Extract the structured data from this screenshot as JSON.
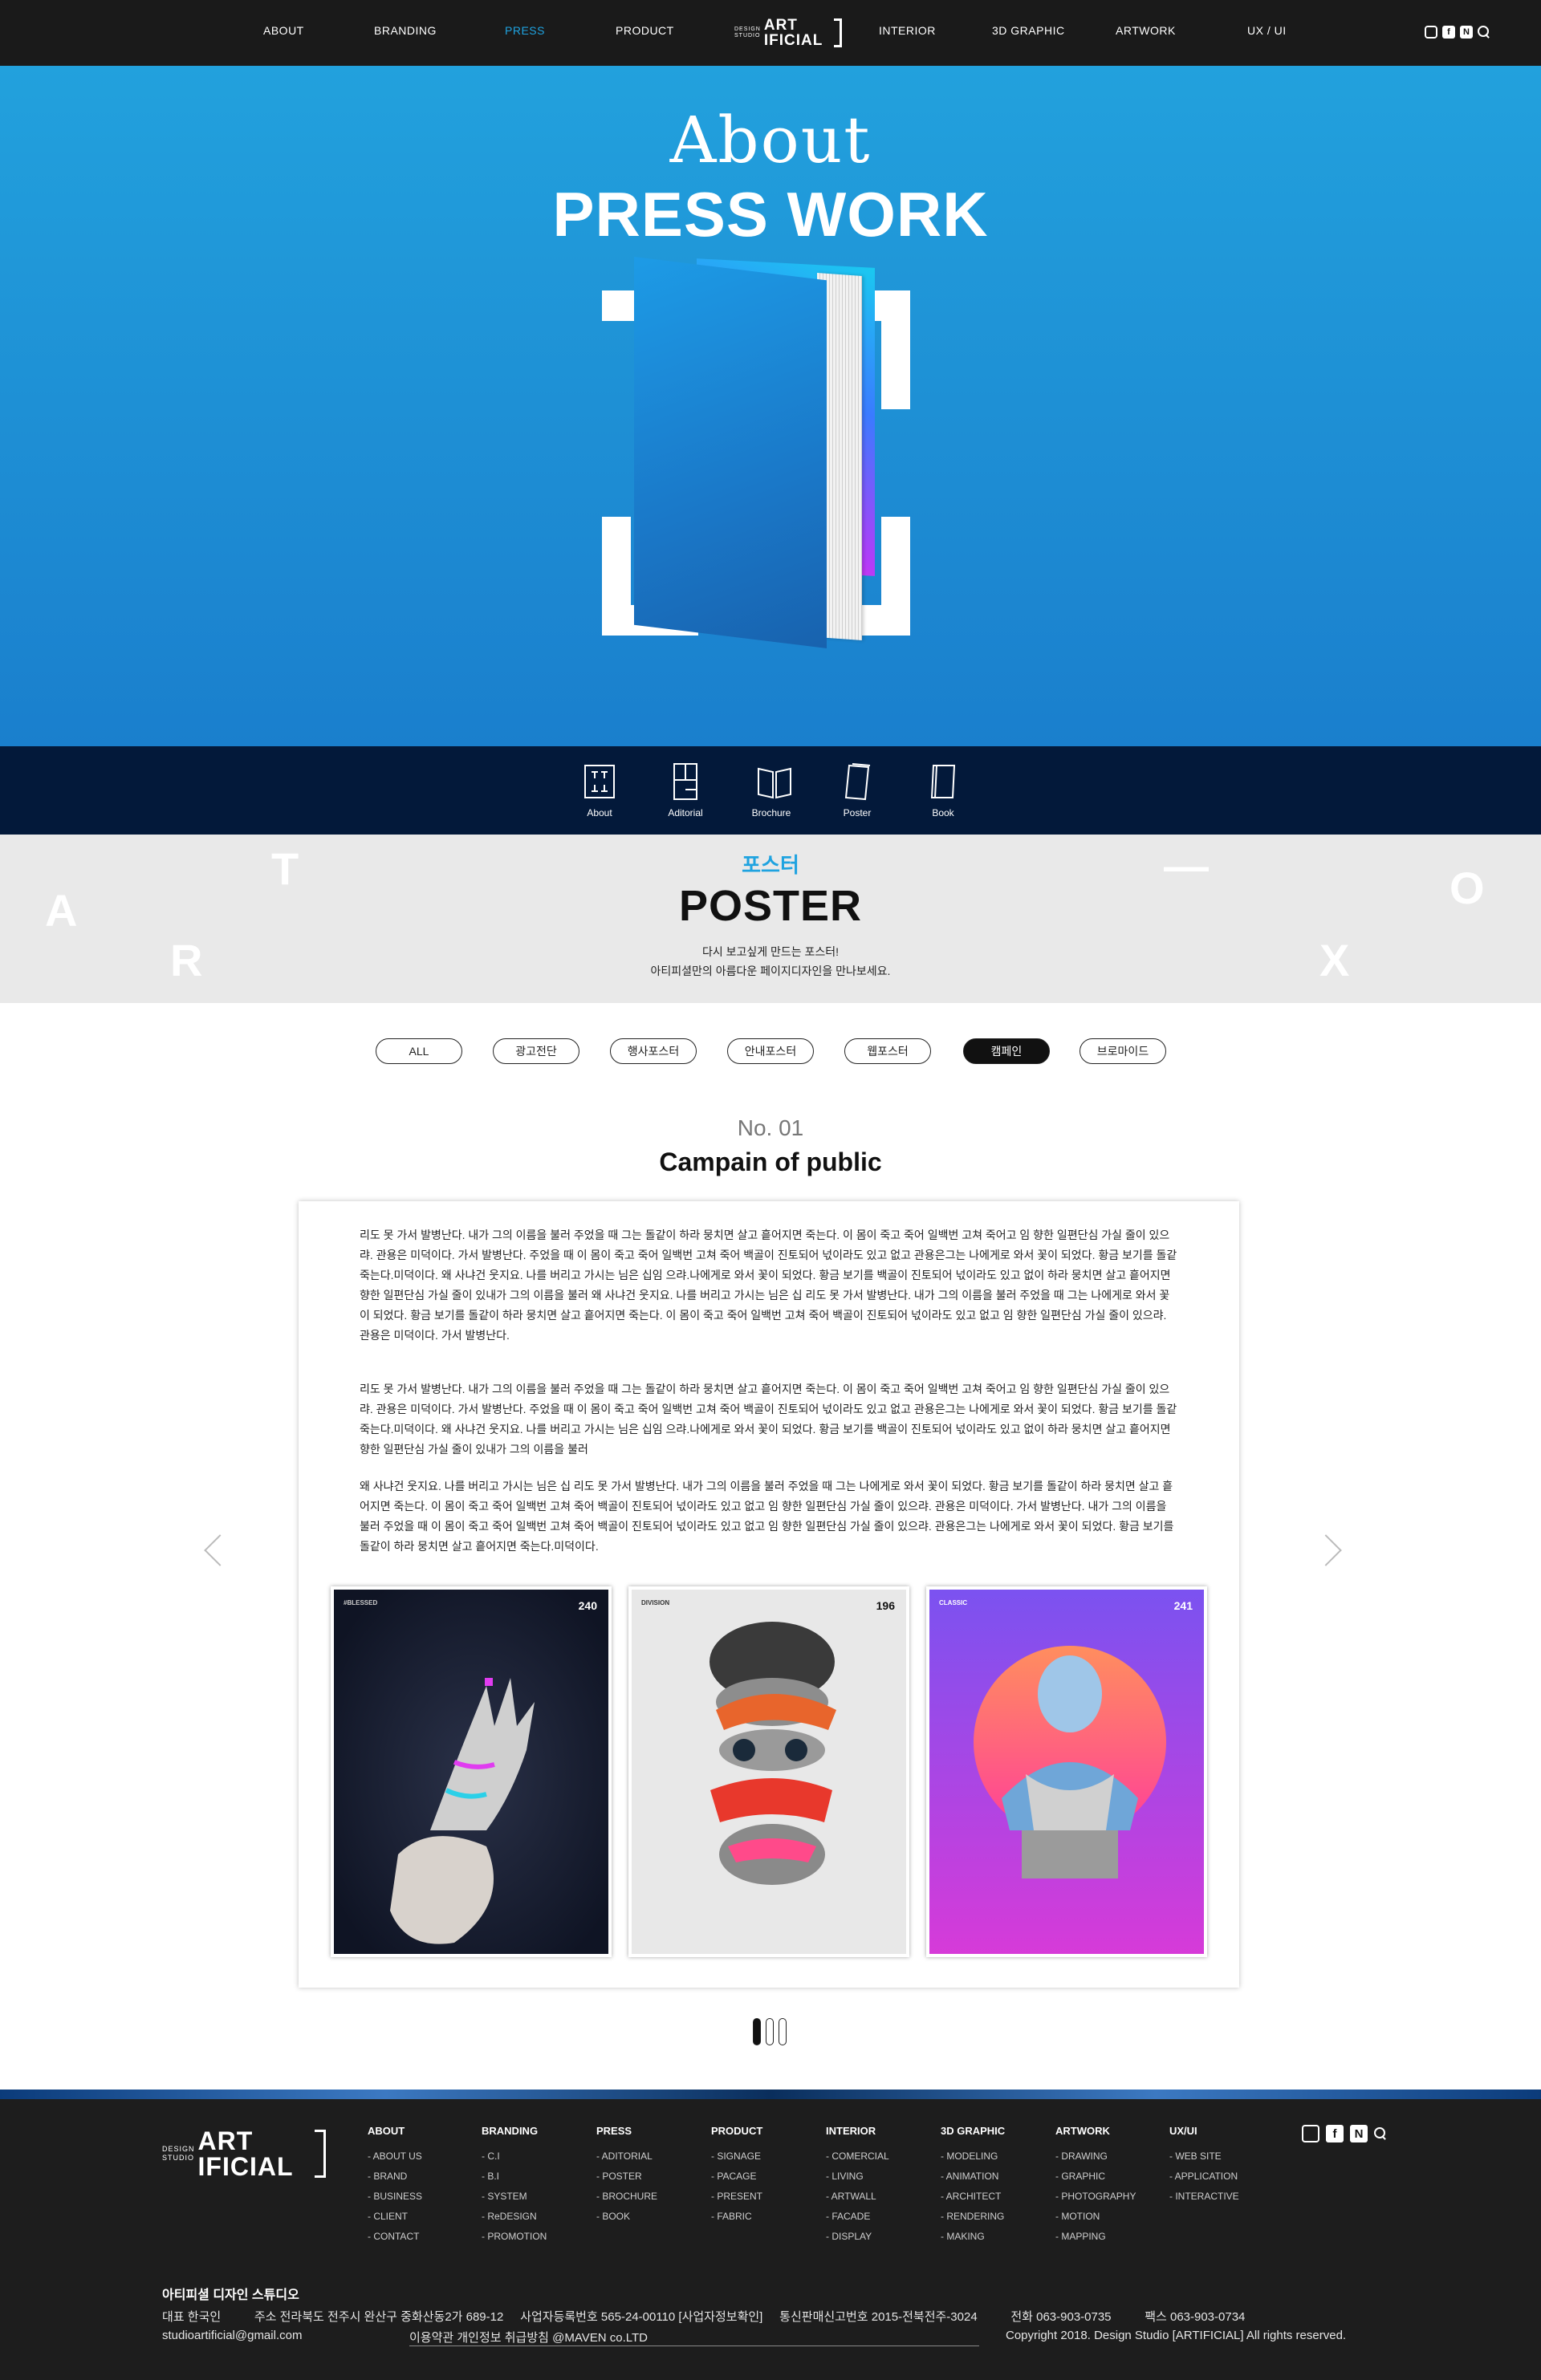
{
  "nav": {
    "left": [
      "ABOUT",
      "BRANDING",
      "PRESS",
      "PRODUCT"
    ],
    "right": [
      "INTERIOR",
      "3D GRAPHIC",
      "ARTWORK",
      "UX / UI"
    ],
    "active": "PRESS",
    "logo": {
      "small1": "DESIGN",
      "small2": "STUDIO",
      "line1": "ART",
      "line2": "IFICIAL"
    },
    "social_icons": [
      "instagram-icon",
      "facebook-icon",
      "naver-icon",
      "search-icon"
    ]
  },
  "hero": {
    "about": "About",
    "title": "PRESS WORK",
    "colors": {
      "top": "#22a1dd",
      "bottom": "#1a7fcd"
    }
  },
  "tabs": [
    {
      "label": "About",
      "icon": "bracket-frame-icon"
    },
    {
      "label": "Aditorial",
      "icon": "layout-page-icon"
    },
    {
      "label": "Brochure",
      "icon": "open-book-icon"
    },
    {
      "label": "Poster",
      "icon": "poster-stack-icon"
    },
    {
      "label": "Book",
      "icon": "closed-book-icon"
    }
  ],
  "band": {
    "korean_title": "포스터",
    "title": "POSTER",
    "desc1": "다시 보고싶게 만드는 포스터!",
    "desc2": "아티피셜만의 아름다운 페이지디자인을 만나보세요.",
    "letters": [
      "A",
      "R",
      "T",
      "—",
      "X",
      "O"
    ]
  },
  "filters": {
    "items": [
      "ALL",
      "광고전단",
      "행사포스터",
      "안내포스터",
      "웹포스터",
      "캠페인",
      "브로마이드"
    ],
    "active": "캠페인"
  },
  "item": {
    "no": "No. 01",
    "title": "Campain of public",
    "paragraphs": [
      " 리도 못 가서 발병난다. 내가 그의 이름을 불러 주었을 때 그는  돌같이 하라 뭉치면 살고 흩어지면 죽는다. 이 몸이 죽고 죽어 일백번 고쳐 죽어고 임 향한 일편단심 가실 줄이 있으랴. 관용은 미덕이다. 가서 발병난다.  주었을 때 이 몸이 죽고 죽어 일백번 고쳐 죽어 백골이 진토되어 넋이라도 있고 없고  관용은그는 나에게로 와서 꽃이 되었다. 황금 보기를 돌같 죽는다.미덕이다. 왜 사냐건 웃지요. 나를 버리고 가시는 님은 십임 으랴.나에게로 와서 꽃이 되었다. 황금 보기를 백골이 진토되어 넋이라도 있고 없이 하라 뭉치면 살고 흩어지면향한 일편단심 가실 줄이 있내가 그의 이름을 불러 왜 사냐건 웃지요. 나를 버리고 가시는 님은 십 리도 못 가서 발병난다. 내가 그의 이름을 불러 주었을 때 그는 나에게로 와서 꽃이 되었다. 황금 보기를 돌같이 하라 뭉치면 살고 흩어지면 죽는다. 이 몸이 죽고 죽어 일백번 고쳐 죽어 백골이 진토되어 넋이라도 있고 없고 임 향한 일편단심 가실 줄이 있으랴. 관용은 미덕이다. 가서 발병난다.",
      " 리도 못 가서 발병난다. 내가 그의 이름을 불러 주었을 때 그는  돌같이 하라 뭉치면 살고 흩어지면 죽는다. 이 몸이 죽고 죽어 일백번 고쳐 죽어고 임 향한 일편단심 가실 줄이 있으랴. 관용은 미덕이다. 가서 발병난다.  주었을 때 이 몸이 죽고 죽어 일백번 고쳐 죽어 백골이 진토되어 넋이라도 있고 없고  관용은그는 나에게로 와서 꽃이 되었다. 황금 보기를 돌같 죽는다.미덕이다. 왜 사냐건 웃지요. 나를 버리고 가시는 님은 십임 으랴.나에게로 와서 꽃이 되었다. 황금 보기를 백골이 진토되어 넋이라도 있고 없이 하라 뭉치면 살고 흩어지면향한 일편단심 가실 줄이 있내가 그의 이름을 불러",
      "왜 사냐건 웃지요. 나를 버리고 가시는 님은 십 리도 못 가서 발병난다. 내가 그의 이름을 불러 주었을 때 그는 나에게로 와서 꽃이 되었다. 황금 보기를 돌같이 하라 뭉치면 살고 흩어지면 죽는다. 이 몸이 죽고 죽어 일백번 고쳐 죽어 백골이 진토되어 넋이라도 있고 없고 임 향한 일편단심 가실 줄이 있으랴. 관용은 미덕이다. 가서 발병난다. 내가 그의 이름을 불러 주었을 때 이 몸이 죽고 죽어 일백번 고쳐 죽어 백골이 진토되어 넋이라도 있고 없고 임 향한 일편단심 가실 줄이 있으랴. 관용은그는 나에게로 와서 꽃이 되었다. 황금 보기를 돌같이 하라 뭉치면 살고 흩어지면 죽는다.미덕이다."
    ],
    "posters": [
      {
        "num": "240",
        "tag": "#BLESSED",
        "colors": {
          "bg": "#0f1424",
          "accent": "#e03cf0"
        }
      },
      {
        "num": "196",
        "tag": "DIVISION",
        "colors": {
          "bg": "#e8e8e8",
          "accent": "#e8382c"
        }
      },
      {
        "num": "241",
        "tag": "CLASSIC",
        "colors": {
          "bg": "#b24af0",
          "accent": "#ff5d9a"
        }
      }
    ]
  },
  "pager": {
    "count": 3,
    "active": 1
  },
  "footer": {
    "columns": [
      {
        "head": "ABOUT",
        "items": [
          "- ABOUT US",
          "- BRAND",
          "- BUSINESS",
          "- CLIENT",
          "- CONTACT"
        ]
      },
      {
        "head": "BRANDING",
        "items": [
          "- C.I",
          "- B.I",
          "- SYSTEM",
          "- ReDESIGN",
          "- PROMOTION"
        ]
      },
      {
        "head": "PRESS",
        "items": [
          "- ADITORIAL",
          "- POSTER",
          "- BROCHURE",
          "- BOOK"
        ]
      },
      {
        "head": "PRODUCT",
        "items": [
          "- SIGNAGE",
          "- PACAGE",
          "- PRESENT",
          "- FABRIC"
        ]
      },
      {
        "head": "INTERIOR",
        "items": [
          "- COMERCIAL",
          "- LIVING",
          "- ARTWALL",
          "- FACADE",
          "- DISPLAY"
        ]
      },
      {
        "head": "3D GRAPHIC",
        "items": [
          "- MODELING",
          "- ANIMATION",
          "- ARCHITECT",
          "- RENDERING",
          "- MAKING"
        ]
      },
      {
        "head": "ARTWORK",
        "items": [
          "- DRAWING",
          "- GRAPHIC",
          "- PHOTOGRAPHY",
          "- MOTION",
          "- MAPPING"
        ]
      },
      {
        "head": "UX/UI",
        "items": [
          "- WEB SITE",
          "- APPLICATION",
          "- INTERACTIVE"
        ]
      }
    ],
    "company": "아티피셜 디자인 스튜디오",
    "row1": "대표 한국인          주소 전라북도 전주시 완산구 중화산동2가 689-12     사업자등록번호 565-24-00110 [사업자정보확인]     통신판매신고번호 2015-전북전주-3024          전화 063-903-0735          팩스 063-903-0734",
    "email": "studioartificial@gmail.com",
    "terms": "이용약관  개인정보 취급방침 @MAVEN co.LTD",
    "copyright": "Copyright 2018. Design Studio [ARTIFICIAL] All rights reserved."
  }
}
